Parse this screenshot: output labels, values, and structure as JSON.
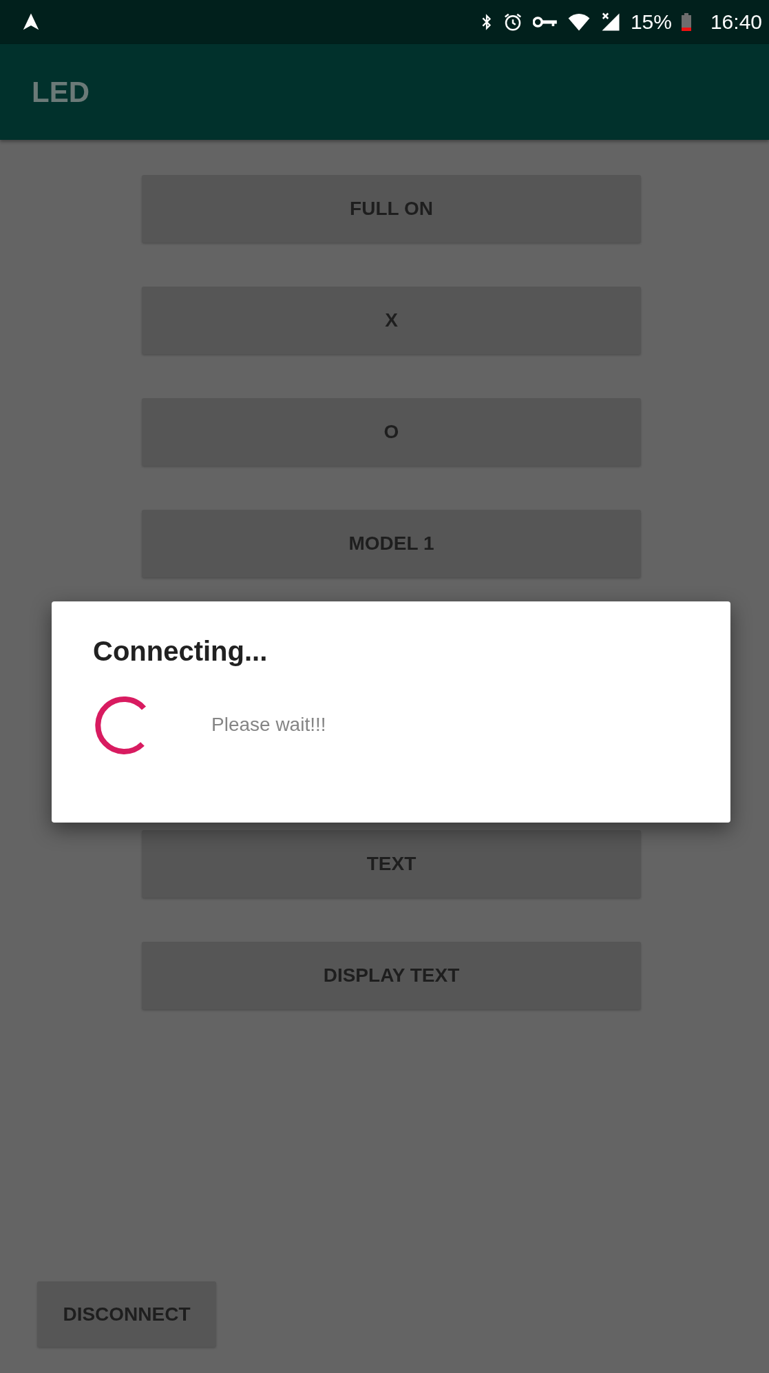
{
  "status_bar": {
    "battery": "15%",
    "time": "16:40"
  },
  "app_bar": {
    "title": "LED"
  },
  "buttons_above_dialog": [
    {
      "label": "FULL ON"
    },
    {
      "label": "X"
    },
    {
      "label": "O"
    },
    {
      "label": "MODEL 1"
    }
  ],
  "buttons_below_dialog": [
    {
      "label": "TEXT"
    },
    {
      "label": "DISPLAY TEXT"
    }
  ],
  "dialog": {
    "title": "Connecting...",
    "message": "Please wait!!!"
  },
  "disconnect_button": {
    "label": "DISCONNECT"
  }
}
